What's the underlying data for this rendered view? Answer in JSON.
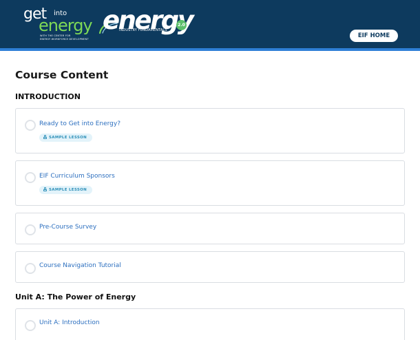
{
  "header": {
    "logo_left": {
      "get": "get",
      "into": "into",
      "energy": "energy",
      "tagline_1": "WITH THE CENTER FOR",
      "tagline_2": "ENERGY WORKFORCE DEVELOPMENT"
    },
    "logo_right": {
      "word": "energy",
      "subtitle": "INDUSTRY FUNDAMENTALS",
      "version": "2.0"
    },
    "home_button_label": "EIF HOME",
    "colors": {
      "header_bg": "#0d3a5e",
      "accent_stripe": "#2e7fd6",
      "logo_green": "#7ed957",
      "badge_green": "#5bbf6a"
    }
  },
  "page_title": "Course Content",
  "sections": [
    {
      "heading": "INTRODUCTION",
      "lessons": [
        {
          "title": "Ready to Get into Energy?",
          "badge": "SAMPLE LESSON"
        },
        {
          "title": "EIF Curriculum Sponsors",
          "badge": "SAMPLE LESSON"
        },
        {
          "title": "Pre-Course Survey"
        },
        {
          "title": "Course Navigation Tutorial"
        }
      ]
    },
    {
      "heading": "Unit A: The Power of Energy",
      "lessons": [
        {
          "title": "Unit A: Introduction"
        }
      ]
    }
  ],
  "icons": {
    "lesson_status": "circle-outline-icon",
    "sample_badge": "lock-icon"
  },
  "colors": {
    "lesson_link": "#2c6fbf",
    "badge_bg": "#e3f3fa",
    "badge_text": "#2c8fb8",
    "card_border": "#d9dde2"
  }
}
